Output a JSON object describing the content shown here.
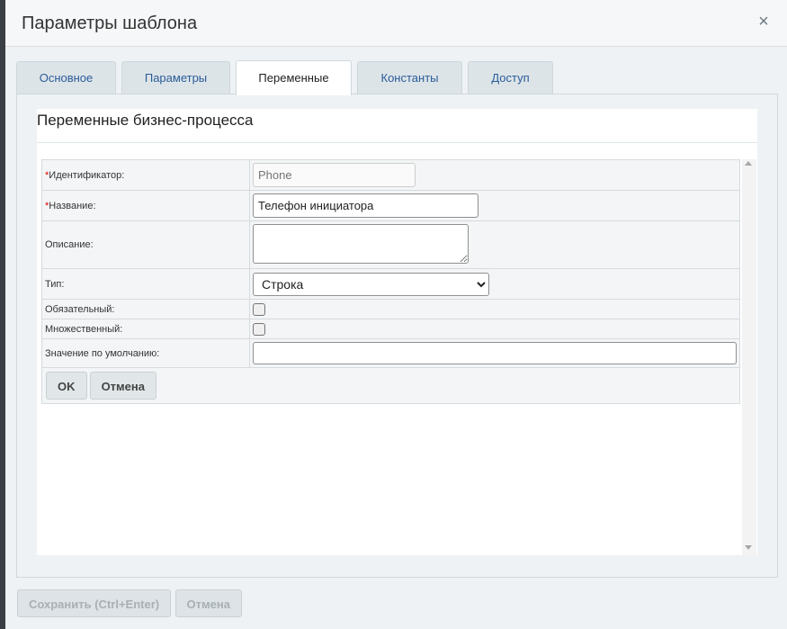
{
  "dialog": {
    "title": "Параметры шаблона",
    "close_icon": "close-icon"
  },
  "tabs": [
    {
      "label": "Основное",
      "active": false
    },
    {
      "label": "Параметры",
      "active": false
    },
    {
      "label": "Переменные",
      "active": true
    },
    {
      "label": "Константы",
      "active": false
    },
    {
      "label": "Доступ",
      "active": false
    }
  ],
  "section": {
    "title": "Переменные бизнес-процесса"
  },
  "form": {
    "id_label": "Идентификатор:",
    "id_placeholder": "Phone",
    "name_label": "Название:",
    "name_value": "Телефон инициатора",
    "desc_label": "Описание:",
    "type_label": "Тип:",
    "type_value": "Строка",
    "required_label": "Обязательный:",
    "multiple_label": "Множественный:",
    "default_label": "Значение по умолчанию:",
    "ok_label": "OK",
    "cancel_label": "Отмена",
    "required_mark": "*"
  },
  "footer": {
    "save_label": "Сохранить (Ctrl+Enter)",
    "cancel_label": "Отмена"
  }
}
